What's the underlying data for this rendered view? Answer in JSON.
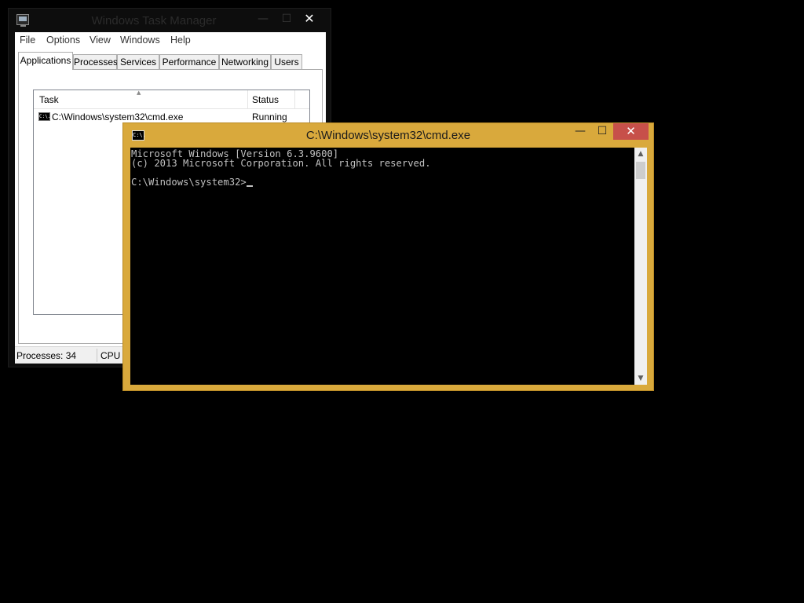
{
  "task_manager": {
    "title": "Windows Task Manager",
    "caption_buttons": {
      "minimize": "—",
      "maximize": "☐",
      "close": "✕"
    },
    "menu": [
      "File",
      "Options",
      "View",
      "Windows",
      "Help"
    ],
    "tabs": [
      {
        "label": "Applications",
        "active": true
      },
      {
        "label": "Processes",
        "active": false
      },
      {
        "label": "Services",
        "active": false
      },
      {
        "label": "Performance",
        "active": false
      },
      {
        "label": "Networking",
        "active": false
      },
      {
        "label": "Users",
        "active": false
      }
    ],
    "columns": {
      "task": "Task",
      "status": "Status"
    },
    "rows": [
      {
        "icon_text": "C:\\.",
        "task": "C:\\Windows\\system32\\cmd.exe",
        "status": "Running"
      }
    ],
    "statusbar": {
      "processes": "Processes: 34",
      "cpu": "CPU U"
    }
  },
  "cmd": {
    "title": "C:\\Windows\\system32\\cmd.exe",
    "icon_text": "C:\\.",
    "caption_buttons": {
      "minimize": "—",
      "maximize": "☐",
      "close": "✕"
    },
    "lines": [
      "Microsoft Windows [Version 6.3.9600]",
      "(c) 2013 Microsoft Corporation. All rights reserved.",
      "",
      "C:\\Windows\\system32>"
    ],
    "scroll": {
      "up": "▲",
      "down": "▼"
    }
  },
  "colors": {
    "desktop": "#000000",
    "cmd_frame": "#d9a93c",
    "close_button": "#c7504a",
    "console_text": "#c0c0c0"
  }
}
